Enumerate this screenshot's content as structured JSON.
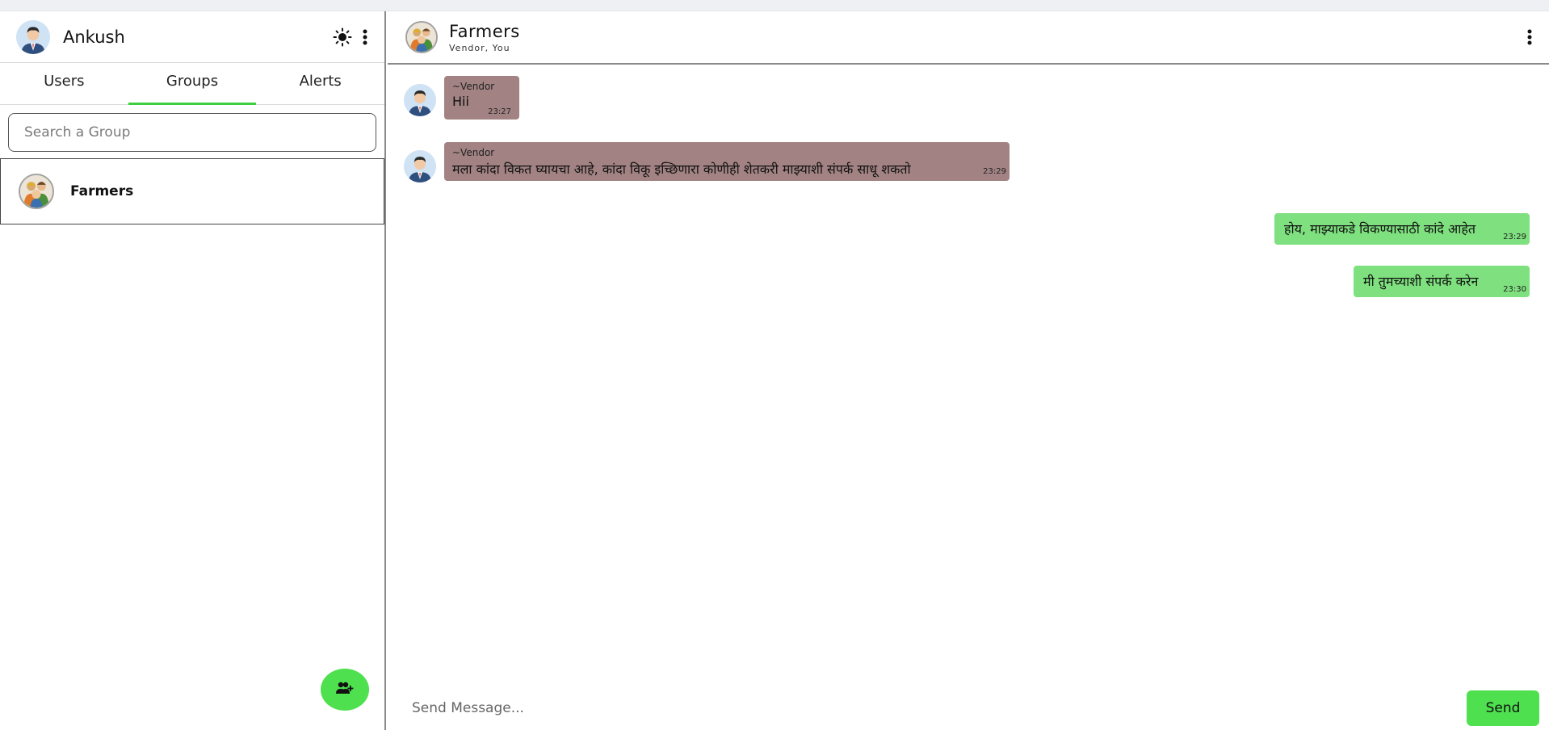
{
  "sidebar": {
    "user_name": "Ankush",
    "tabs": [
      {
        "label": "Users"
      },
      {
        "label": "Groups"
      },
      {
        "label": "Alerts"
      }
    ],
    "search_placeholder": "Search a Group",
    "groups": [
      {
        "name": "Farmers"
      }
    ]
  },
  "chat": {
    "title": "Farmers",
    "members": "Vendor, You",
    "messages": [
      {
        "sender": "~Vendor",
        "text": "Hii",
        "time": "23:27"
      },
      {
        "sender": "~Vendor",
        "text": "मला कांदा विकत घ्यायचा आहे, कांदा विकू इच्छिणारा कोणीही शेतकरी माझ्याशी संपर्क साधू शकतो",
        "time": "23:29"
      },
      {
        "text": "होय, माझ्याकडे विकण्यासाठी कांदे आहेत",
        "time": "23:29"
      },
      {
        "text": "मी तुमच्याशी संपर्क करेन",
        "time": "23:30"
      }
    ],
    "composer_placeholder": "Send Message...",
    "send_label": "Send"
  },
  "colors": {
    "accent": "#4ee04e",
    "incoming_bubble": "#a28282",
    "outgoing_bubble": "#7ee07e"
  }
}
